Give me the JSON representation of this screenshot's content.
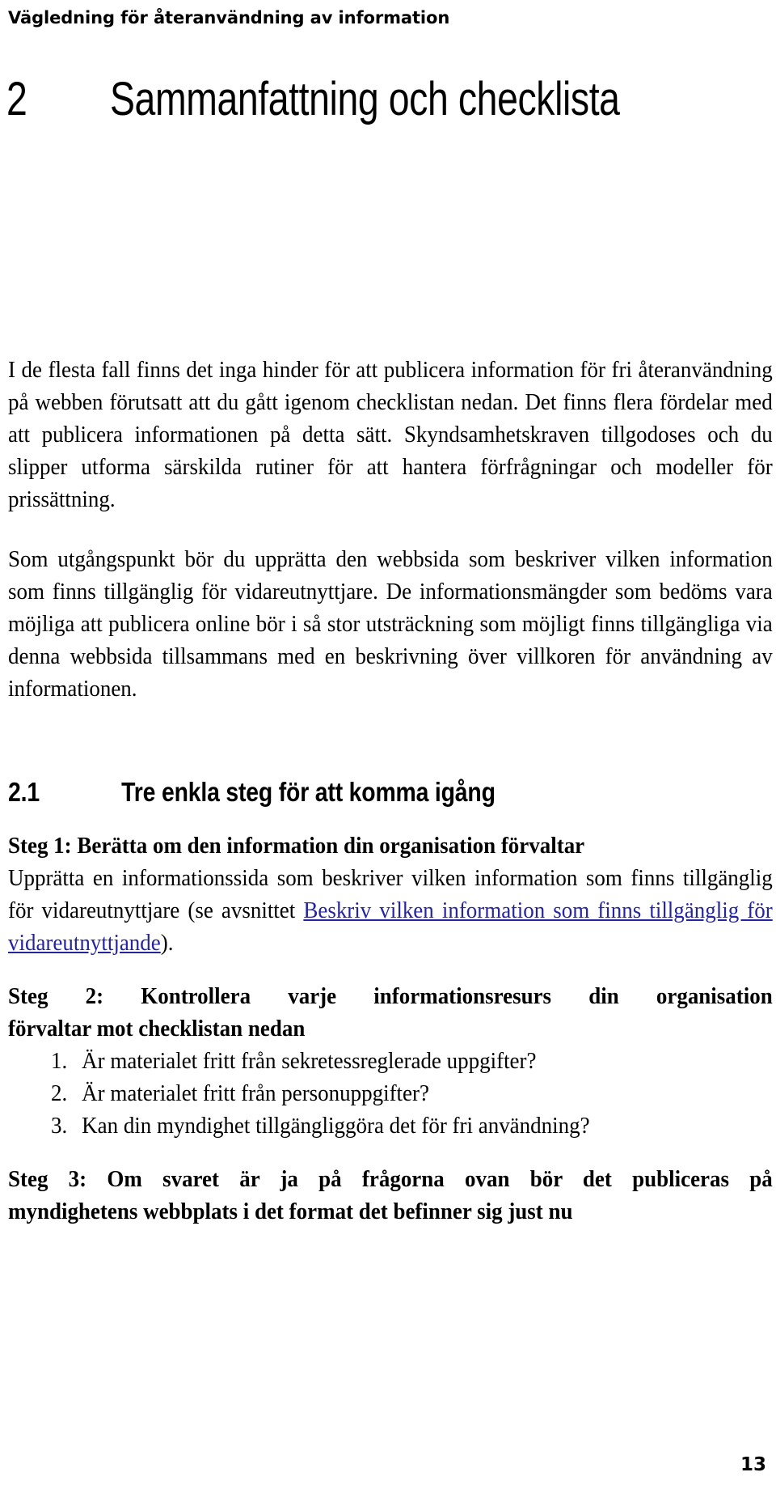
{
  "document": {
    "running_header": "Vägledning för återanvändning av information",
    "page_number": "13",
    "link_color": "#2424a0"
  },
  "chapter": {
    "number": "2",
    "title": "Sammanfattning och checklista"
  },
  "intro": {
    "paragraph_1": "I de flesta fall finns det inga hinder för att publicera information för fri återanvändning på webben förutsatt att du gått igenom checklistan nedan. Det finns flera fördelar med att publicera informationen på detta sätt. Skyndsamhetskraven tillgodoses och du slipper utforma särskilda rutiner för att hantera förfrågningar och modeller för prissättning.",
    "paragraph_2": "Som utgångspunkt bör du upprätta den webbsida som beskriver vilken information som finns tillgänglig för vidareutnyttjare. De informationsmängder som bedöms vara möjliga att publicera online bör i så stor utsträckning som möjligt finns tillgängliga via denna webbsida tillsammans med en beskrivning över villkoren för användning av informationen."
  },
  "section": {
    "number": "2.1",
    "title": "Tre enkla steg för att komma igång"
  },
  "steps": {
    "step1": {
      "heading": "Steg 1: Berätta om den information din organisation förvaltar",
      "body_before_link": "Upprätta en informationssida som beskriver vilken information som finns tillgänglig för vidareutnyttjare (se avsnittet ",
      "link_text": "Beskriv vilken information som finns tillgänglig för vidareutnyttjande",
      "body_after_link": ")."
    },
    "step2": {
      "heading_line1": "Steg 2: Kontrollera varje informationsresurs din organisation",
      "heading_line2": "förvaltar mot checklistan nedan",
      "checklist": [
        {
          "num": "1.",
          "text": "Är materialet fritt från sekretessreglerade uppgifter?"
        },
        {
          "num": "2.",
          "text": "Är materialet fritt från personuppgifter?"
        },
        {
          "num": "3.",
          "text": "Kan din myndighet tillgängliggöra det för fri användning?"
        }
      ]
    },
    "step3": {
      "heading_line1": "Steg 3: Om svaret är ja på frågorna ovan bör det publiceras på",
      "heading_line2": "myndighetens webbplats i det format det befinner sig just nu"
    }
  }
}
